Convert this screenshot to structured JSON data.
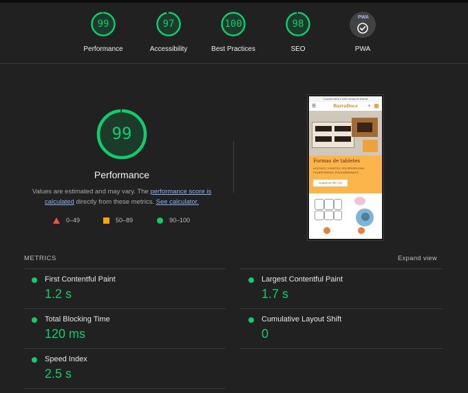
{
  "categories": [
    {
      "id": "performance",
      "score": "99",
      "label": "Performance"
    },
    {
      "id": "accessibility",
      "score": "97",
      "label": "Accessibility"
    },
    {
      "id": "best-practices",
      "score": "100",
      "label": "Best Practices"
    },
    {
      "id": "seo",
      "score": "98",
      "label": "SEO"
    }
  ],
  "pwa": {
    "label": "PWA",
    "badge_text": "PWA"
  },
  "performance": {
    "score": "99",
    "score_fraction": 0.99,
    "title": "Performance",
    "desc_prefix": "Values are estimated and may vary. The ",
    "desc_link1": "performance score is calculated",
    "desc_middle": " directly from these metrics. ",
    "desc_link2": "See calculator."
  },
  "legend": {
    "fail": "0–49",
    "average": "50–89",
    "pass": "90–100"
  },
  "colors": {
    "pass": "#0cce6b",
    "average": "#ffa400",
    "fail": "#ff4e42"
  },
  "screenshot": {
    "promo": "Conecte online e retire na loja em Moema",
    "brand": "BarraDoce",
    "card_title": "Formas de tabletes",
    "card_subtitle": "ACETATO, 3 PARTES, POLIPROPILENO, POLIESTIRENO, POLICARBONATO",
    "card_button": "A partir de R$ 7,90"
  },
  "metrics": {
    "title": "METRICS",
    "expand_label": "Expand view",
    "items": [
      {
        "name": "First Contentful Paint",
        "value": "1.2 s"
      },
      {
        "name": "Largest Contentful Paint",
        "value": "1.7 s"
      },
      {
        "name": "Total Blocking Time",
        "value": "120 ms"
      },
      {
        "name": "Cumulative Layout Shift",
        "value": "0"
      },
      {
        "name": "Speed Index",
        "value": "2.5 s"
      }
    ]
  }
}
